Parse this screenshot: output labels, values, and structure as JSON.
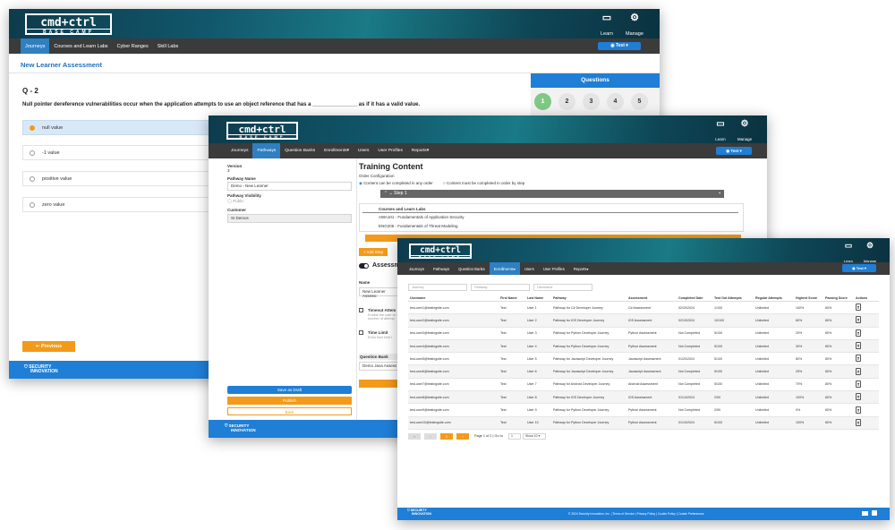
{
  "logo": {
    "main": "cmd+ctrl",
    "sub": "BASE CAMP"
  },
  "header_icons": {
    "learn": "Learn",
    "manage": "Manage",
    "user": "Test"
  },
  "w1": {
    "nav": [
      "Journeys",
      "Courses and Learn Labs",
      "Cyber Ranges",
      "Skill Labs"
    ],
    "page_title": "New Learner Assessment",
    "q_number": "Q - 2",
    "question": "Null pointer dereference vulnerabilities occur when the application attempts to use an object reference that has a _______________ as if it has a valid value.",
    "options": [
      "null value",
      "-1 value",
      "positive value",
      "zero value"
    ],
    "questions_panel_title": "Questions",
    "question_numbers": [
      "1",
      "2",
      "3",
      "4",
      "5"
    ],
    "previous": "Previous"
  },
  "w2": {
    "nav": [
      "Journeys",
      "Pathways",
      "Question Banks",
      "Enrollments",
      "Users",
      "User Profiles",
      "Reports"
    ],
    "version_label": "Version",
    "version_value": "3",
    "pathway_name_label": "Pathway Name",
    "pathway_name_value": "Demo - New Learner",
    "visibility_label": "Pathway Visibility",
    "visibility_value": "Public",
    "customer_label": "Customer",
    "customer_value": "SI Demos",
    "save_draft": "Save as Draft",
    "publish": "Publish",
    "back": "Back",
    "title": "Training Content",
    "order_config": "Order Configuration",
    "order_opt1": "Content can be completed in any order",
    "order_opt2": "Content must be completed in order by step",
    "step": "Step 1",
    "courses_header": "Courses and Learn Labs",
    "courses": [
      "AWA101 - Fundamentals of Application Security",
      "ENG205 - Fundamentals of Threat Modeling"
    ],
    "add_step": "+ Add Step",
    "assess_label": "Assessm",
    "name_label": "Name",
    "name_value": "New Learner Assessi",
    "timeout_label": "Timeout Attem",
    "timeout_desc": "Enable the user to number of attemp",
    "timelimit_label": "Time Limit",
    "timelimit_desc": "Enter time limit i",
    "qbank_label": "Question Bank",
    "qbank_value": "Demo Java Assess"
  },
  "w3": {
    "nav": [
      "Journeys",
      "Pathways",
      "Question Banks",
      "Enrollments",
      "Users",
      "User Profiles",
      "Reports"
    ],
    "filters": [
      "Journey",
      "Pathway",
      "Username"
    ],
    "columns": [
      "Username",
      "First Name",
      "Last Name",
      "Pathway",
      "Assessment",
      "Completed Date",
      "Test Out Attempts",
      "Regular Attempts",
      "Highest Score",
      "Passing Score",
      "Actions"
    ],
    "rows": [
      [
        "test-user1@testingsite.com",
        "Test",
        "User 1",
        "Pathway for C# Developer Journey",
        "C# Assessment",
        "02/20/2024",
        "1/100",
        "Unlimited",
        "100%",
        "80%"
      ],
      [
        "test-user2@testingsite.com",
        "Test",
        "User 2",
        "Pathway for iOS Developer Journey",
        "iOS Assessment",
        "02/19/2024",
        "10/100",
        "Unlimited",
        "80%",
        "80%"
      ],
      [
        "test-user3@testingsite.com",
        "Test",
        "User 3",
        "Pathway for Python Developer Journey",
        "Python Assessment",
        "Not Completed",
        "5/100",
        "Unlimited",
        "20%",
        "80%"
      ],
      [
        "test-user4@testingsite.com",
        "Test",
        "User 4",
        "Pathway for Python Developer Journey",
        "Python Assessment",
        "Not Completed",
        "5/100",
        "Unlimited",
        "30%",
        "80%"
      ],
      [
        "test-user5@testingsite.com",
        "Test",
        "User 5",
        "Pathway for Javascript Developer Journey",
        "Javascript Assessment",
        "01/20/2024",
        "5/100",
        "Unlimited",
        "80%",
        "80%"
      ],
      [
        "test-user6@testingsite.com",
        "Test",
        "User 6",
        "Pathway for Javascript Developer Journey",
        "Javascript Assessment",
        "Not Completed",
        "5/100",
        "Unlimited",
        "25%",
        "80%"
      ],
      [
        "test-user7@testingsite.com",
        "Test",
        "User 7",
        "Pathway for Android Developer Journey",
        "Android Assessment",
        "Not Completed",
        "5/100",
        "Unlimited",
        "70%",
        "80%"
      ],
      [
        "test-user8@testingsite.com",
        "Test",
        "User 8",
        "Pathway for iOS Developer Journey",
        "iOS Assessment",
        "01/14/2024",
        "2/00",
        "Unlimited",
        "100%",
        "80%"
      ],
      [
        "test-user9@testingsite.com",
        "Test",
        "User 9",
        "Pathway for Python Developer Journey",
        "Python Assessment",
        "Not Completed",
        "2/00",
        "Unlimited",
        "0%",
        "80%"
      ],
      [
        "test-user10@testingsite.com",
        "Test",
        "User 10",
        "Pathway for Python Developer Journey",
        "Python Assessment",
        "01/10/2024",
        "5/100",
        "Unlimited",
        "100%",
        "80%"
      ]
    ],
    "pager_text": "Page 1 of 2 | Go to",
    "page_input": "1",
    "current_page": "1",
    "show_select": "Show 10",
    "copyright": "© 2024 Security Innovation, Inc. | Terms of Service | Privacy Policy | Cookie Policy | Cookie Preferences"
  },
  "footer_brand": {
    "line1": "SECURITY",
    "line2": "INNOVATION"
  },
  "colors": {
    "accent": "#1f7ed6",
    "orange": "#f39a1a",
    "nav": "#3b3b3b",
    "header": "#11566a",
    "done": "#7ec983"
  }
}
